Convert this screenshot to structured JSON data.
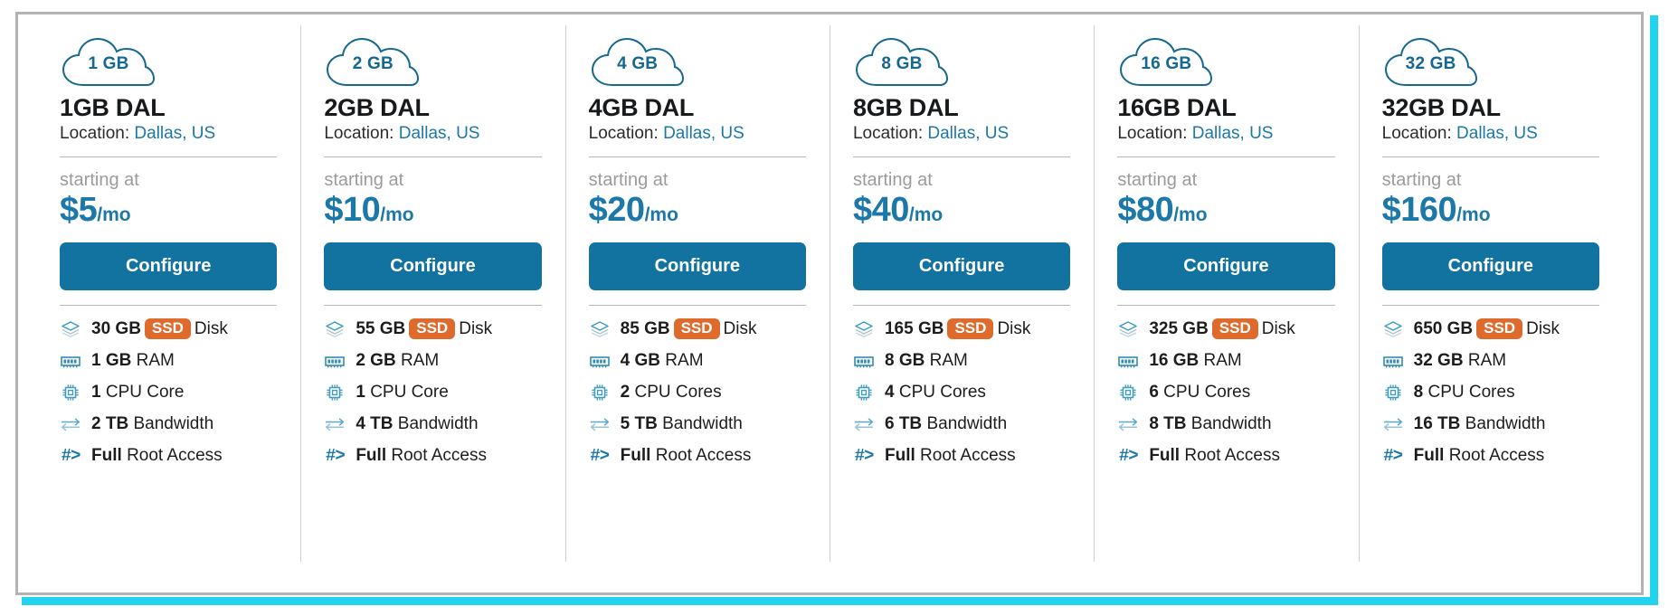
{
  "theme": {
    "accent_cyan": "#22d3ee",
    "brand_blue": "#1272a0",
    "price_blue": "#1b78a8",
    "ssd_orange": "#de6b2b",
    "icon_teal": "#3c9cc4",
    "border_gray": "#b3b3b3"
  },
  "labels": {
    "location_prefix": "Location:",
    "starting_at": "starting at",
    "configure": "Configure",
    "period": "/mo",
    "ssd": "SSD",
    "root_glyph": "#>"
  },
  "cards": [
    {
      "badge": "1 GB",
      "title": "1GB DAL",
      "location": "Dallas, US",
      "price": "$5",
      "specs": {
        "disk_size": "30 GB",
        "disk_label": "Disk",
        "ram": "1 GB",
        "ram_label": "RAM",
        "cpu": "1",
        "cpu_label": "CPU Core",
        "bandwidth": "2 TB",
        "bandwidth_label": "Bandwidth",
        "root": "Full",
        "root_label": "Root Access"
      }
    },
    {
      "badge": "2 GB",
      "title": "2GB DAL",
      "location": "Dallas, US",
      "price": "$10",
      "specs": {
        "disk_size": "55 GB",
        "disk_label": "Disk",
        "ram": "2 GB",
        "ram_label": "RAM",
        "cpu": "1",
        "cpu_label": "CPU Core",
        "bandwidth": "4 TB",
        "bandwidth_label": "Bandwidth",
        "root": "Full",
        "root_label": "Root Access"
      }
    },
    {
      "badge": "4 GB",
      "title": "4GB DAL",
      "location": "Dallas, US",
      "price": "$20",
      "specs": {
        "disk_size": "85 GB",
        "disk_label": "Disk",
        "ram": "4 GB",
        "ram_label": "RAM",
        "cpu": "2",
        "cpu_label": "CPU Cores",
        "bandwidth": "5 TB",
        "bandwidth_label": "Bandwidth",
        "root": "Full",
        "root_label": "Root Access"
      }
    },
    {
      "badge": "8 GB",
      "title": "8GB DAL",
      "location": "Dallas, US",
      "price": "$40",
      "specs": {
        "disk_size": "165 GB",
        "disk_label": "Disk",
        "ram": "8 GB",
        "ram_label": "RAM",
        "cpu": "4",
        "cpu_label": "CPU Cores",
        "bandwidth": "6 TB",
        "bandwidth_label": "Bandwidth",
        "root": "Full",
        "root_label": "Root Access"
      }
    },
    {
      "badge": "16 GB",
      "title": "16GB DAL",
      "location": "Dallas, US",
      "price": "$80",
      "specs": {
        "disk_size": "325 GB",
        "disk_label": "Disk",
        "ram": "16 GB",
        "ram_label": "RAM",
        "cpu": "6",
        "cpu_label": "CPU Cores",
        "bandwidth": "8 TB",
        "bandwidth_label": "Bandwidth",
        "root": "Full",
        "root_label": "Root Access"
      }
    },
    {
      "badge": "32 GB",
      "title": "32GB DAL",
      "location": "Dallas, US",
      "price": "$160",
      "specs": {
        "disk_size": "650 GB",
        "disk_label": "Disk",
        "ram": "32 GB",
        "ram_label": "RAM",
        "cpu": "8",
        "cpu_label": "CPU Cores",
        "bandwidth": "16 TB",
        "bandwidth_label": "Bandwidth",
        "root": "Full",
        "root_label": "Root Access"
      }
    }
  ]
}
